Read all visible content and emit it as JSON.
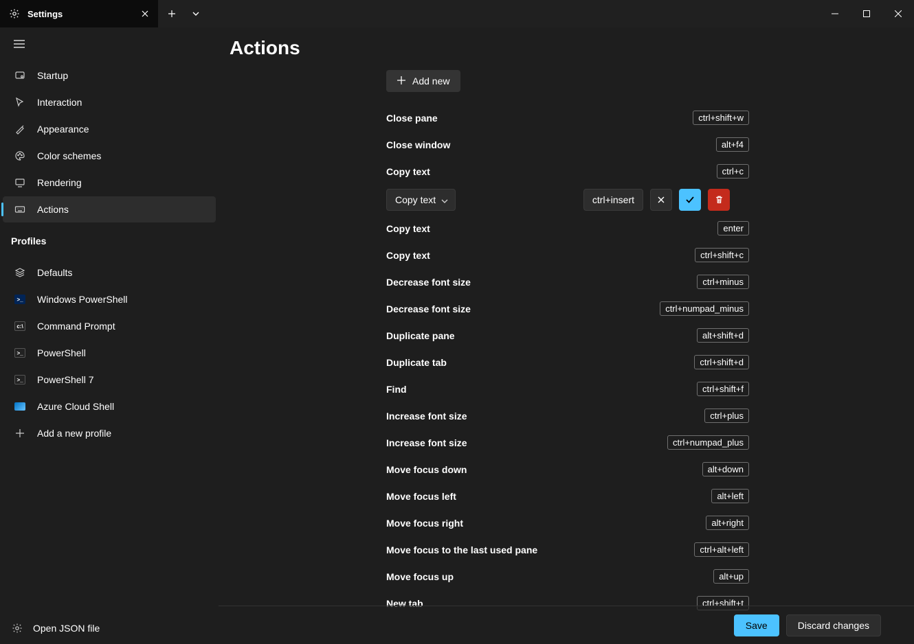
{
  "titlebar": {
    "tab_title": "Settings"
  },
  "sidebar": {
    "items": [
      {
        "label": "Startup"
      },
      {
        "label": "Interaction"
      },
      {
        "label": "Appearance"
      },
      {
        "label": "Color schemes"
      },
      {
        "label": "Rendering"
      },
      {
        "label": "Actions"
      }
    ],
    "profiles_header": "Profiles",
    "profiles": [
      {
        "label": "Defaults"
      },
      {
        "label": "Windows PowerShell"
      },
      {
        "label": "Command Prompt"
      },
      {
        "label": "PowerShell"
      },
      {
        "label": "PowerShell 7"
      },
      {
        "label": "Azure Cloud Shell"
      },
      {
        "label": "Add a new profile"
      }
    ],
    "footer_label": "Open JSON file"
  },
  "page": {
    "title": "Actions",
    "add_new_label": "Add new",
    "edit_row": {
      "dropdown_value": "Copy text",
      "keybind_value": "ctrl+insert"
    },
    "actions": [
      {
        "label": "Close pane",
        "key": "ctrl+shift+w"
      },
      {
        "label": "Close window",
        "key": "alt+f4"
      },
      {
        "label": "Copy text",
        "key": "ctrl+c"
      },
      {
        "label": "Copy text",
        "key": "enter"
      },
      {
        "label": "Copy text",
        "key": "ctrl+shift+c"
      },
      {
        "label": "Decrease font size",
        "key": "ctrl+minus"
      },
      {
        "label": "Decrease font size",
        "key": "ctrl+numpad_minus"
      },
      {
        "label": "Duplicate pane",
        "key": "alt+shift+d"
      },
      {
        "label": "Duplicate tab",
        "key": "ctrl+shift+d"
      },
      {
        "label": "Find",
        "key": "ctrl+shift+f"
      },
      {
        "label": "Increase font size",
        "key": "ctrl+plus"
      },
      {
        "label": "Increase font size",
        "key": "ctrl+numpad_plus"
      },
      {
        "label": "Move focus down",
        "key": "alt+down"
      },
      {
        "label": "Move focus left",
        "key": "alt+left"
      },
      {
        "label": "Move focus right",
        "key": "alt+right"
      },
      {
        "label": "Move focus to the last used pane",
        "key": "ctrl+alt+left"
      },
      {
        "label": "Move focus up",
        "key": "alt+up"
      },
      {
        "label": "New tab",
        "key": "ctrl+shift+t"
      }
    ]
  },
  "footer": {
    "save_label": "Save",
    "discard_label": "Discard changes"
  }
}
